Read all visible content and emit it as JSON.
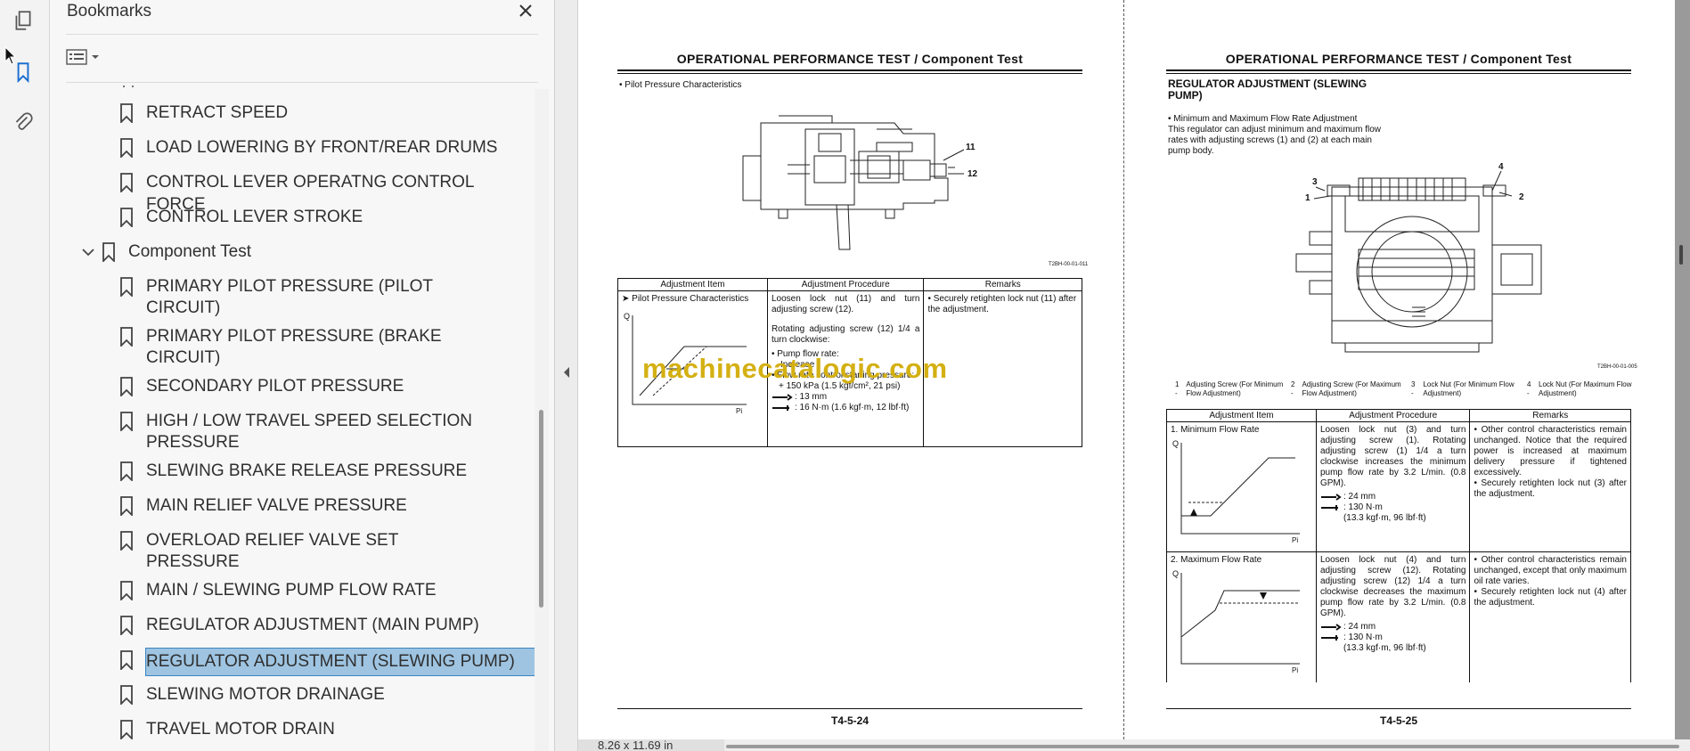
{
  "app": {
    "panel_title": "Bookmarks",
    "page_size_label": "8.26 x 11.69 in"
  },
  "bookmarks": [
    {
      "label": "RETRACT SPEED"
    },
    {
      "label": "LOAD LOWERING BY FRONT/REAR DRUMS"
    },
    {
      "label": "CONTROL LEVER OPERATNG CONTROL FORCE"
    },
    {
      "label": "CONTROL LEVER STROKE"
    },
    {
      "label": "Component Test"
    },
    {
      "label": "PRIMARY PILOT PRESSURE (PILOT",
      "label2": "CIRCUIT)"
    },
    {
      "label": "PRIMARY PILOT PRESSURE (BRAKE",
      "label2": "CIRCUIT)"
    },
    {
      "label": "SECONDARY PILOT PRESSURE"
    },
    {
      "label": "HIGH / LOW TRAVEL SPEED SELECTION",
      "label2": "PRESSURE"
    },
    {
      "label": "SLEWING BRAKE RELEASE PRESSURE"
    },
    {
      "label": "MAIN RELIEF VALVE PRESSURE"
    },
    {
      "label": "OVERLOAD RELIEF VALVE SET",
      "label2": "PRESSURE"
    },
    {
      "label": "MAIN / SLEWING PUMP FLOW RATE"
    },
    {
      "label": "REGULATOR ADJUSTMENT (MAIN PUMP)"
    },
    {
      "label": "REGULATOR ADJUSTMENT (SLEWING PUMP)"
    },
    {
      "label": "SLEWING MOTOR DRAINAGE"
    },
    {
      "label": "TRAVEL MOTOR DRAIN"
    }
  ],
  "page_left": {
    "title": "OPERATIONAL PERFORMANCE TEST / Component Test",
    "bullet": "• Pilot Pressure Characteristics",
    "callouts": [
      "11",
      "12"
    ],
    "fig_code": "T2BH-00-01-011",
    "table_headers": [
      "Adjustment Item",
      "Adjustment Procedure",
      "Remarks"
    ],
    "item": "➤ Pilot Pressure Characteristics",
    "axis_q": "Q",
    "axis_pi": "Pi",
    "proc1": "Loosen lock nut (11) and turn adjusting screw (12).",
    "proc2": "Rotating adjusting screw (12) 1/4 a turn clockwise:",
    "proc3": "• Pump flow rate:",
    "proc3b": "Increase",
    "proc4": "• Flow rate control starting pressure:",
    "proc5": "+ 150 kPa (1.5 kgf/cm², 21 psi)",
    "proc6": ": 13 mm",
    "proc7": ": 16 N·m (1.6 kgf·m, 12 lbf·ft)",
    "remark": "• Securely retighten lock nut (11) after the adjustment.",
    "page_number": "T4-5-24"
  },
  "page_right": {
    "title": "OPERATIONAL PERFORMANCE TEST / Component Test",
    "heading": "REGULATOR ADJUSTMENT (SLEWING PUMP)",
    "bullet": "• Minimum and Maximum Flow Rate Adjustment",
    "intro": "This regulator can adjust minimum and maximum flow rates with adjusting screws (1) and (2) at each main pump body.",
    "callouts": [
      "1",
      "2",
      "3",
      "4"
    ],
    "fig_code": "T2BH-00-01-005",
    "legend": [
      {
        "num": "1 -",
        "text": "Adjusting Screw (For Minimum Flow Adjustment)"
      },
      {
        "num": "2 -",
        "text": "Adjusting Screw (For Maximum Flow Adjustment)"
      },
      {
        "num": "3 -",
        "text": "Lock Nut (For Minimum Flow Adjustment)"
      },
      {
        "num": "4 -",
        "text": "Lock Nut (For Maximum Flow Adjustment)"
      }
    ],
    "table_headers": [
      "Adjustment Item",
      "Adjustment Procedure",
      "Remarks"
    ],
    "row1_item": "1. Minimum Flow Rate",
    "row1_proc": "Loosen lock nut (3) and turn adjusting screw (1). Rotating adjusting screw (1) 1/4 a turn clockwise increases the minimum pump flow rate by 3.2 L/min. (0.8 GPM).",
    "row1_tool1": ": 24 mm",
    "row1_tool2": ": 130 N·m",
    "row1_tool3": "(13.3 kgf·m, 96 lbf·ft)",
    "row1_rem1": "• Other control characteristics remain unchanged. Notice that the required power is increased at maximum delivery pressure if tightened excessively.",
    "row1_rem2": "• Securely retighten lock nut (3) after the adjustment.",
    "row2_item": "2. Maximum Flow Rate",
    "row2_proc": "Loosen lock nut (4) and turn adjusting screw (12). Rotating adjusting screw (12) 1/4 a turn clockwise decreases the maximum pump flow rate by 3.2 L/min. (0.8 GPM).",
    "row2_tool1": ": 24 mm",
    "row2_tool2": ": 130 N·m",
    "row2_tool3": "(13.3 kgf·m, 96 lbf·ft)",
    "row2_rem1": "• Other control characteristics remain unchanged, except that only maximum oil rate varies.",
    "row2_rem2": "• Securely retighten lock nut (4) after the adjustment.",
    "axis_q": "Q",
    "axis_pi": "Pi",
    "page_number": "T4-5-25"
  },
  "watermark": "machinecatalogic.com",
  "colors": {
    "selection": "#9ec4e1",
    "watermark": "#d4b012",
    "active_icon": "#1c6fd1"
  }
}
